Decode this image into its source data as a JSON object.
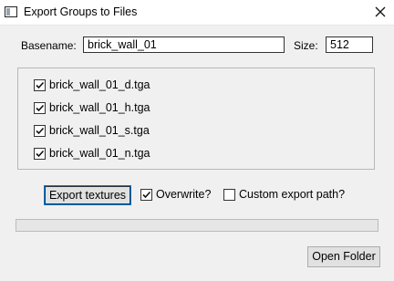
{
  "window": {
    "title": "Export Groups to Files"
  },
  "basename": {
    "label": "Basename:",
    "value": "brick_wall_01"
  },
  "size": {
    "label": "Size:",
    "value": "512"
  },
  "files": [
    {
      "name": "brick_wall_01_d.tga",
      "checked": true
    },
    {
      "name": "brick_wall_01_h.tga",
      "checked": true
    },
    {
      "name": "brick_wall_01_s.tga",
      "checked": true
    },
    {
      "name": "brick_wall_01_n.tga",
      "checked": true
    }
  ],
  "actions": {
    "export_label": "Export textures",
    "overwrite": {
      "label": "Overwrite?",
      "checked": true
    },
    "custom_path": {
      "label": "Custom export path?",
      "checked": false
    }
  },
  "progress": {
    "fraction": 0
  },
  "open_folder_label": "Open Folder"
}
